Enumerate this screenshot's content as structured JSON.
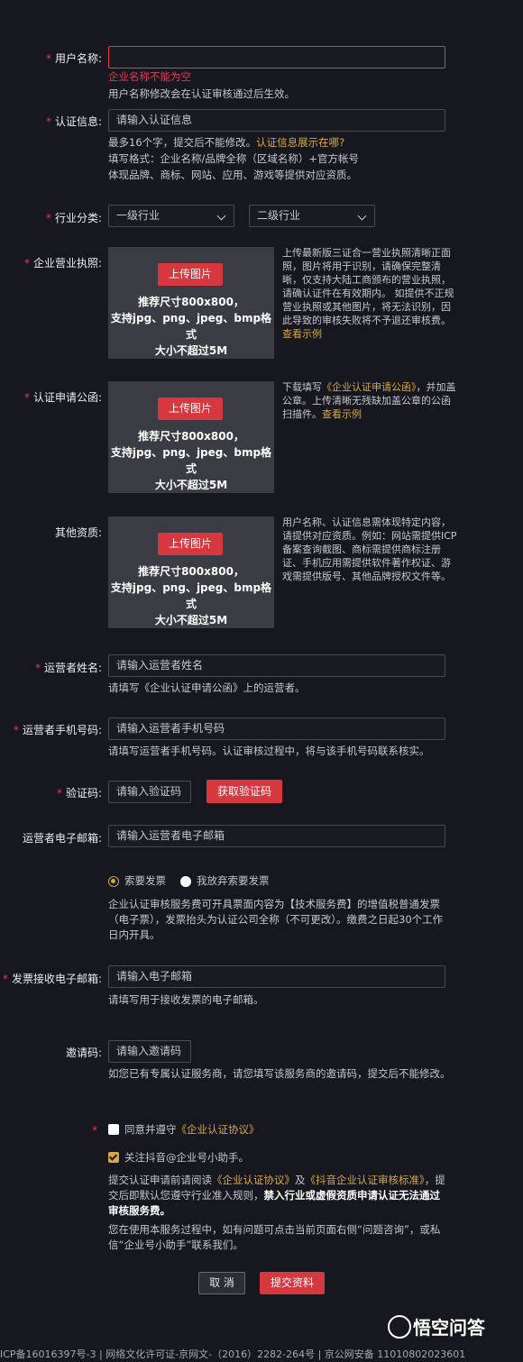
{
  "fields": {
    "username": {
      "label": "用户名称:",
      "value": "",
      "error": "企业名称不能为空",
      "hint": "用户名称修改会在认证审核通过后生效。"
    },
    "cert_info": {
      "label": "认证信息:",
      "placeholder": "请输入认证信息",
      "hint1": "最多16个字，提交后不能修改。",
      "hint1_link": "认证信息展示在哪?",
      "hint2": "填写格式：企业名称/品牌全称（区域名称）+官方帐号",
      "hint3": "体现品牌、商标、网站、应用、游戏等提供对应资质。"
    },
    "industry": {
      "label": "行业分类:",
      "level1": "一级行业",
      "level2": "二级行业"
    },
    "license": {
      "label": "企业营业执照:",
      "desc": "上传最新版三证合一营业执照清晰正面照，图片将用于识别，请确保完整清晰，仅支持大陆工商颁布的营业执照，请确认证件在有效期内。 如提供不正规营业执照或其他图片，将无法识别，因此导致的审核失败将不予退还审核费。",
      "example": "查看示例"
    },
    "letter": {
      "label": "认证申请公函:",
      "desc_pre": "下载填写",
      "desc_link": "《企业认证申请公函》",
      "desc_post": "，并加盖公章。上传清晰无残缺加盖公章的公函扫描件。",
      "example": "查看示例"
    },
    "other": {
      "label": "其他资质:",
      "desc": "用户名称、认证信息需体现特定内容，请提供对应资质。例如：网站需提供ICP备案查询截图、商标需提供商标注册证、手机应用需提供软件著作权证、游戏需提供版号、其他品牌授权文件等。"
    },
    "operator_name": {
      "label": "运营者姓名:",
      "placeholder": "请输入运营者姓名",
      "hint": "请填写《企业认证申请公函》上的运营者。"
    },
    "operator_phone": {
      "label": "运营者手机号码:",
      "placeholder": "请输入运营者手机号码",
      "hint": "请填写运营者手机号码。认证审核过程中，将与该手机号码联系核实。"
    },
    "code": {
      "label": "验证码:",
      "placeholder": "请输入验证码",
      "button": "获取验证码"
    },
    "operator_email": {
      "label": "运营者电子邮箱:",
      "placeholder": "请输入运营者电子邮箱"
    },
    "invoice": {
      "option1": "索要发票",
      "option2": "我放弃索要发票",
      "desc": "企业认证审核服务费可开具票面内容为【技术服务费】的增值税普通发票（电子票），发票抬头为认证公司全称（不可更改）。缴费之日起30个工作日内开具。"
    },
    "invoice_email": {
      "label": "发票接收电子邮箱:",
      "placeholder": "请输入电子邮箱",
      "hint": "请填写用于接收发票的电子邮箱。"
    },
    "invite": {
      "label": "邀请码:",
      "placeholder": "请输入邀请码",
      "hint": "如您已有专属认证服务商，请您填写该服务商的邀请码，提交后不能修改。"
    }
  },
  "upload": {
    "button": "上传图片",
    "line1": "推荐尺寸800x800，",
    "line2": "支持jpg、png、jpeg、bmp格式",
    "line3": "大小不超过5M"
  },
  "agreement": {
    "check1_pre": "同意并遵守",
    "check1_link": "《企业认证协议》",
    "check2": "关注抖音@企业号小助手。",
    "note_pre": "提交认证申请前请阅读",
    "note_link1": "《企业认证协议》",
    "note_mid": "及",
    "note_link2": "《抖音企业认证审核标准》",
    "note_post": "，提交后即默认您遵守行业准入规则，",
    "note_bold": "禁入行业或虚假资质申请认证无法通过审核服务费。",
    "contact": "您在使用本服务过程中，如有问题可点击当前页面右侧“问题咨询”，或私信“企业号小助手”联系我们。"
  },
  "actions": {
    "cancel": "取 消",
    "submit": "提交资料"
  },
  "footer": {
    "text": "ICP备16016397号-3  |  网络文化许可证-京网文-（2016）2282-264号  |  京公网安备 11010802023601"
  },
  "watermark": {
    "text": "悟空问答"
  },
  "colors": {
    "accent": "#d7373f",
    "link": "#d6a840",
    "background": "#17171f"
  }
}
